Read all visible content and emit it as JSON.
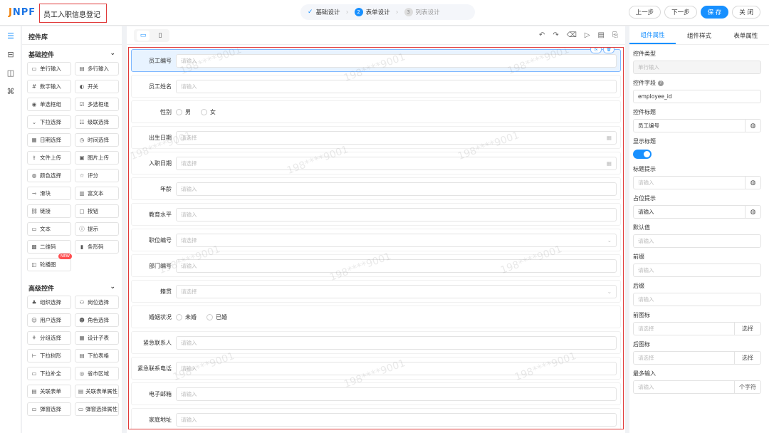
{
  "header": {
    "logo": "JNPF",
    "title": "员工入职信息登记",
    "steps": [
      {
        "num": "",
        "label": "基础设计"
      },
      {
        "num": "2",
        "label": "表单设计"
      },
      {
        "num": "3",
        "label": "列表设计"
      }
    ],
    "buttons": {
      "prev": "上一步",
      "next": "下一步",
      "save": "保 存",
      "close": "关 闭"
    }
  },
  "library": {
    "title": "控件库",
    "basic_title": "基础控件",
    "basic": [
      {
        "icon": "▭",
        "label": "单行输入"
      },
      {
        "icon": "▤",
        "label": "多行输入"
      },
      {
        "icon": "#",
        "label": "数字输入"
      },
      {
        "icon": "◐",
        "label": "开关"
      },
      {
        "icon": "◉",
        "label": "单选框组"
      },
      {
        "icon": "☑",
        "label": "多选框组"
      },
      {
        "icon": "⌄",
        "label": "下拉选择"
      },
      {
        "icon": "☷",
        "label": "级联选择"
      },
      {
        "icon": "▦",
        "label": "日期选择"
      },
      {
        "icon": "◷",
        "label": "时间选择"
      },
      {
        "icon": "⇪",
        "label": "文件上传"
      },
      {
        "icon": "▣",
        "label": "图片上传"
      },
      {
        "icon": "◍",
        "label": "颜色选择"
      },
      {
        "icon": "☆",
        "label": "评分"
      },
      {
        "icon": "⊸",
        "label": "滑块"
      },
      {
        "icon": "▥",
        "label": "富文本"
      },
      {
        "icon": "⛓",
        "label": "链接"
      },
      {
        "icon": "▢",
        "label": "按钮"
      },
      {
        "icon": "▭",
        "label": "文本"
      },
      {
        "icon": "ⓘ",
        "label": "提示"
      },
      {
        "icon": "▩",
        "label": "二维码"
      },
      {
        "icon": "▮",
        "label": "条形码"
      },
      {
        "icon": "◫",
        "label": "轮播图",
        "badge": "NEW"
      }
    ],
    "advanced_title": "高级控件",
    "advanced": [
      {
        "icon": "♣",
        "label": "组织选择"
      },
      {
        "icon": "⚇",
        "label": "岗位选择"
      },
      {
        "icon": "☺",
        "label": "用户选择"
      },
      {
        "icon": "☻",
        "label": "角色选择"
      },
      {
        "icon": "⚘",
        "label": "分组选择"
      },
      {
        "icon": "▦",
        "label": "设计子表"
      },
      {
        "icon": "⊢",
        "label": "下拉树形"
      },
      {
        "icon": "▤",
        "label": "下拉表格"
      },
      {
        "icon": "▭",
        "label": "下拉补全"
      },
      {
        "icon": "◎",
        "label": "省市区域"
      },
      {
        "icon": "▤",
        "label": "关联表单"
      },
      {
        "icon": "▤",
        "label": "关联表单属性"
      },
      {
        "icon": "▭",
        "label": "弹窗选择"
      },
      {
        "icon": "▭",
        "label": "弹窗选择属性"
      }
    ]
  },
  "form": {
    "watermark": "198****9001",
    "fields": [
      {
        "label": "员工编号",
        "kind": "input",
        "placeholder": "请输入",
        "selected": true
      },
      {
        "label": "员工姓名",
        "kind": "input",
        "placeholder": "请输入"
      },
      {
        "label": "性别",
        "kind": "radio",
        "options": [
          "男",
          "女"
        ]
      },
      {
        "label": "出生日期",
        "kind": "date",
        "placeholder": "请选择"
      },
      {
        "label": "入职日期",
        "kind": "date",
        "placeholder": "请选择"
      },
      {
        "label": "年龄",
        "kind": "input",
        "placeholder": "请输入"
      },
      {
        "label": "教育水平",
        "kind": "input",
        "placeholder": "请输入"
      },
      {
        "label": "职位编号",
        "kind": "select",
        "placeholder": "请选择"
      },
      {
        "label": "部门编号",
        "kind": "input",
        "placeholder": "请输入"
      },
      {
        "label": "籍贯",
        "kind": "select",
        "placeholder": "请选择"
      },
      {
        "label": "婚姻状况",
        "kind": "radio",
        "options": [
          "未婚",
          "已婚"
        ]
      },
      {
        "label": "紧急联系人",
        "kind": "input",
        "placeholder": "请输入"
      },
      {
        "label": "紧急联系电话",
        "kind": "input",
        "placeholder": "请输入"
      },
      {
        "label": "电子邮箱",
        "kind": "input",
        "placeholder": "请输入"
      },
      {
        "label": "家庭地址",
        "kind": "input",
        "placeholder": "请输入"
      }
    ]
  },
  "props": {
    "tabs": [
      "组件属性",
      "组件样式",
      "表单属性"
    ],
    "items": [
      {
        "label": "控件类型",
        "value": "单行输入",
        "type": "disabled"
      },
      {
        "label": "控件字段",
        "value": "employee_id",
        "type": "text",
        "help": "?"
      },
      {
        "label": "控件标题",
        "value": "员工编号",
        "type": "globe"
      },
      {
        "label": "显示标题",
        "type": "toggle"
      },
      {
        "label": "标题提示",
        "value": "请输入",
        "type": "globe",
        "muted": true
      },
      {
        "label": "占位提示",
        "value": "请输入",
        "type": "globe"
      },
      {
        "label": "默认值",
        "value": "请输入",
        "type": "text",
        "muted": true
      },
      {
        "label": "前缀",
        "value": "请输入",
        "type": "text",
        "muted": true
      },
      {
        "label": "后缀",
        "value": "请输入",
        "type": "text",
        "muted": true
      },
      {
        "label": "前图标",
        "value": "请选择",
        "type": "btn",
        "btn": "选择",
        "muted": true
      },
      {
        "label": "后图标",
        "value": "请选择",
        "type": "btn",
        "btn": "选择",
        "muted": true
      },
      {
        "label": "最多输入",
        "value": "请输入",
        "type": "btn",
        "btn": "个字符",
        "muted": true
      }
    ]
  },
  "colors": {
    "primary": "#1890ff",
    "highlight": "#e03a3a",
    "logo_orange": "#ef7d00"
  }
}
